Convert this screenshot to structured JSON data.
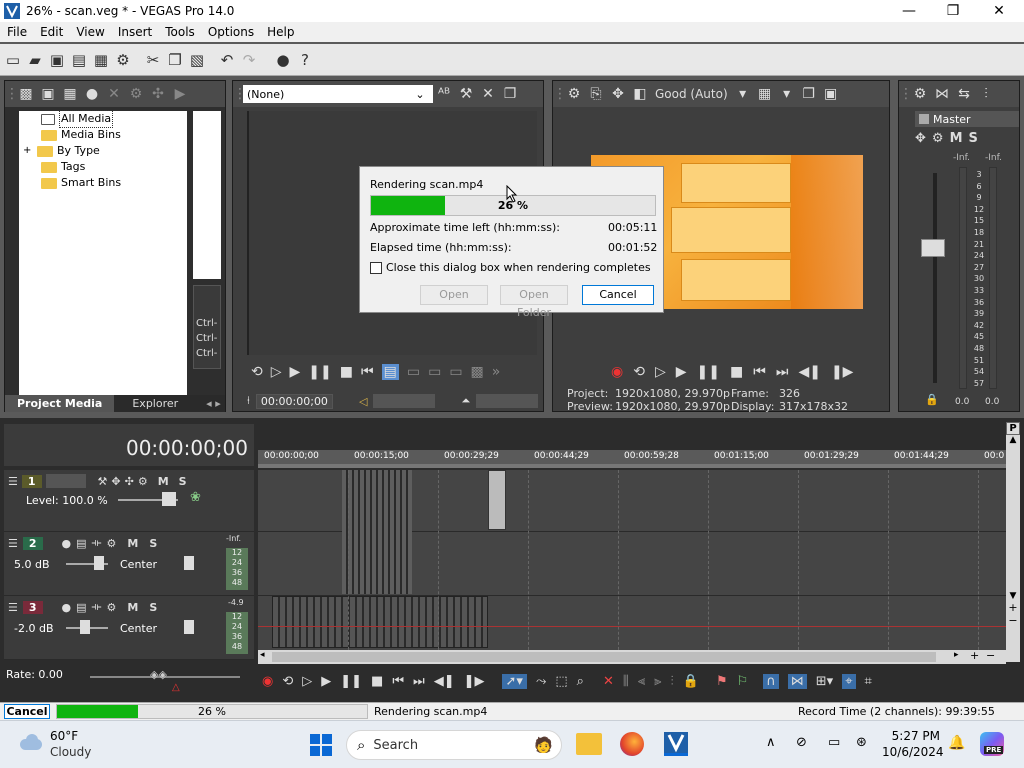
{
  "window": {
    "title": "26% - scan.veg * - VEGAS Pro 14.0",
    "minimize": "—",
    "maximize": "❐",
    "close": "✕"
  },
  "menu": [
    "File",
    "Edit",
    "View",
    "Insert",
    "Tools",
    "Options",
    "Help"
  ],
  "project_media": {
    "items": [
      "All Media",
      "Media Bins",
      "By Type",
      "Tags",
      "Smart Bins"
    ],
    "expand_symbol": "+",
    "tab_active": "Project Media",
    "tab_inactive": "Explorer",
    "ctrl_labels": [
      "Ctrl-",
      "Ctrl-",
      "Ctrl-"
    ]
  },
  "trimmer": {
    "dropdown_value": "(None)",
    "timecode": "00:00:00;00"
  },
  "preview": {
    "quality": "Good (Auto)",
    "project_label": "Project:",
    "project_value": "1920x1080, 29.970p",
    "preview_label": "Preview:",
    "preview_value": "1920x1080, 29.970p",
    "frame_label": "Frame:",
    "frame_value": "326",
    "display_label": "Display:",
    "display_value": "317x178x32"
  },
  "master": {
    "title": "Master",
    "m_label": "M",
    "s_label": "S",
    "inf_left": "-Inf.",
    "inf_right": "-Inf.",
    "scale": [
      "3",
      "6",
      "9",
      "12",
      "15",
      "18",
      "21",
      "24",
      "27",
      "30",
      "33",
      "36",
      "39",
      "42",
      "45",
      "48",
      "51",
      "54",
      "57"
    ],
    "bottom_left": "0.0",
    "bottom_right": "0.0"
  },
  "render_dialog": {
    "title": "Rendering scan.mp4",
    "progress_percent": 26,
    "progress_text": "26 %",
    "time_left_label": "Approximate time left (hh:mm:ss):",
    "time_left_value": "00:05:11",
    "elapsed_label": "Elapsed time (hh:mm:ss):",
    "elapsed_value": "00:01:52",
    "checkbox_label": "Close this dialog box when rendering completes",
    "open_label": "Open",
    "open_folder_label": "Open Folder",
    "cancel_label": "Cancel"
  },
  "timeline": {
    "timecode": "00:00:00;00",
    "ruler": [
      "00:00:00;00",
      "00:00:15;00",
      "00:00:29;29",
      "00:00:44;29",
      "00:00:59;28",
      "00:01:15;00",
      "00:01:29;29",
      "00:01:44;29",
      "00:0"
    ],
    "rate_label": "Rate: 0.00",
    "tracks": [
      {
        "num": "1",
        "level": "Level: 100.0 %",
        "m": "M",
        "s": "S"
      },
      {
        "num": "2",
        "level": "5.0 dB",
        "pan": "Center",
        "m": "M",
        "s": "S",
        "meter_top": "-Inf.",
        "meter": [
          "12",
          "24",
          "36",
          "48"
        ]
      },
      {
        "num": "3",
        "level": "-2.0 dB",
        "pan": "Center",
        "m": "M",
        "s": "S",
        "meter_top": "-4.9",
        "meter": [
          "12",
          "24",
          "36",
          "48"
        ]
      }
    ],
    "marker_p": "P"
  },
  "statusbar": {
    "cancel_label": "Cancel",
    "progress_percent": 26,
    "progress_text": "26 %",
    "status_text": "Rendering scan.mp4",
    "record_time": "Record Time (2 channels): 99:39:55"
  },
  "taskbar": {
    "weather_temp": "60°F",
    "weather_desc": "Cloudy",
    "search_label": "Search",
    "time": "5:27 PM",
    "date": "10/6/2024",
    "copilot_badge": "PRE"
  },
  "colors": {
    "progress_green": "#0fb40f",
    "accent_blue": "#0078d7",
    "track_red": "#a33",
    "track1": "#5b5b2a",
    "track2": "#2a6b4a",
    "track3": "#7a2a3a"
  }
}
